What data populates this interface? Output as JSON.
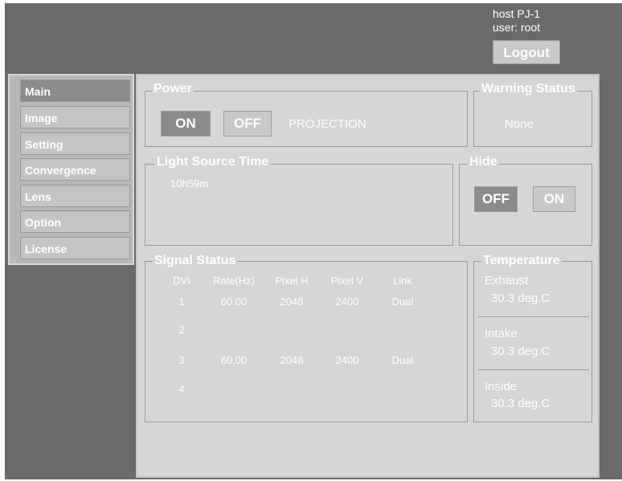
{
  "header": {
    "host": "host PJ-1",
    "user": "user: root",
    "logout_label": "Logout"
  },
  "sidebar": {
    "items": [
      {
        "label": "Main",
        "active": true
      },
      {
        "label": "Image",
        "active": false
      },
      {
        "label": "Setting",
        "active": false
      },
      {
        "label": "Convergence",
        "active": false
      },
      {
        "label": "Lens",
        "active": false
      },
      {
        "label": "Option",
        "active": false
      },
      {
        "label": "License",
        "active": false
      }
    ]
  },
  "power": {
    "title": "Power",
    "on_label": "ON",
    "off_label": "OFF",
    "state": "PROJECTION"
  },
  "warning": {
    "title": "Warning Status",
    "value": "None"
  },
  "light_source": {
    "title": "Light Source Time",
    "value": "10h59m"
  },
  "hide": {
    "title": "Hide",
    "off_label": "OFF",
    "on_label": "ON"
  },
  "signal": {
    "title": "Signal Status",
    "columns": [
      "DVI",
      "Rate(Hz)",
      "Pixel H",
      "Pixel V",
      "Link"
    ],
    "rows": [
      [
        "1",
        "60.00",
        "2048",
        "2400",
        "Dual"
      ],
      [
        "2",
        "",
        "",
        "",
        ""
      ],
      [
        "3",
        "60.00",
        "2048",
        "2400",
        "Dual"
      ],
      [
        "4",
        "",
        "",
        "",
        ""
      ]
    ]
  },
  "temperature": {
    "title": "Temperature",
    "items": [
      {
        "label": "Exhaust",
        "value": "30.3 deg.C"
      },
      {
        "label": "Intake",
        "value": "30.3 deg.C"
      },
      {
        "label": "Inside",
        "value": "30.3 deg.C"
      }
    ]
  },
  "colors": {
    "frame": "#6a6a6a",
    "panel": "#d6d6d6",
    "active_button": "#8c8c8c",
    "button": "#c8c8c8",
    "text": "#ffffff"
  }
}
